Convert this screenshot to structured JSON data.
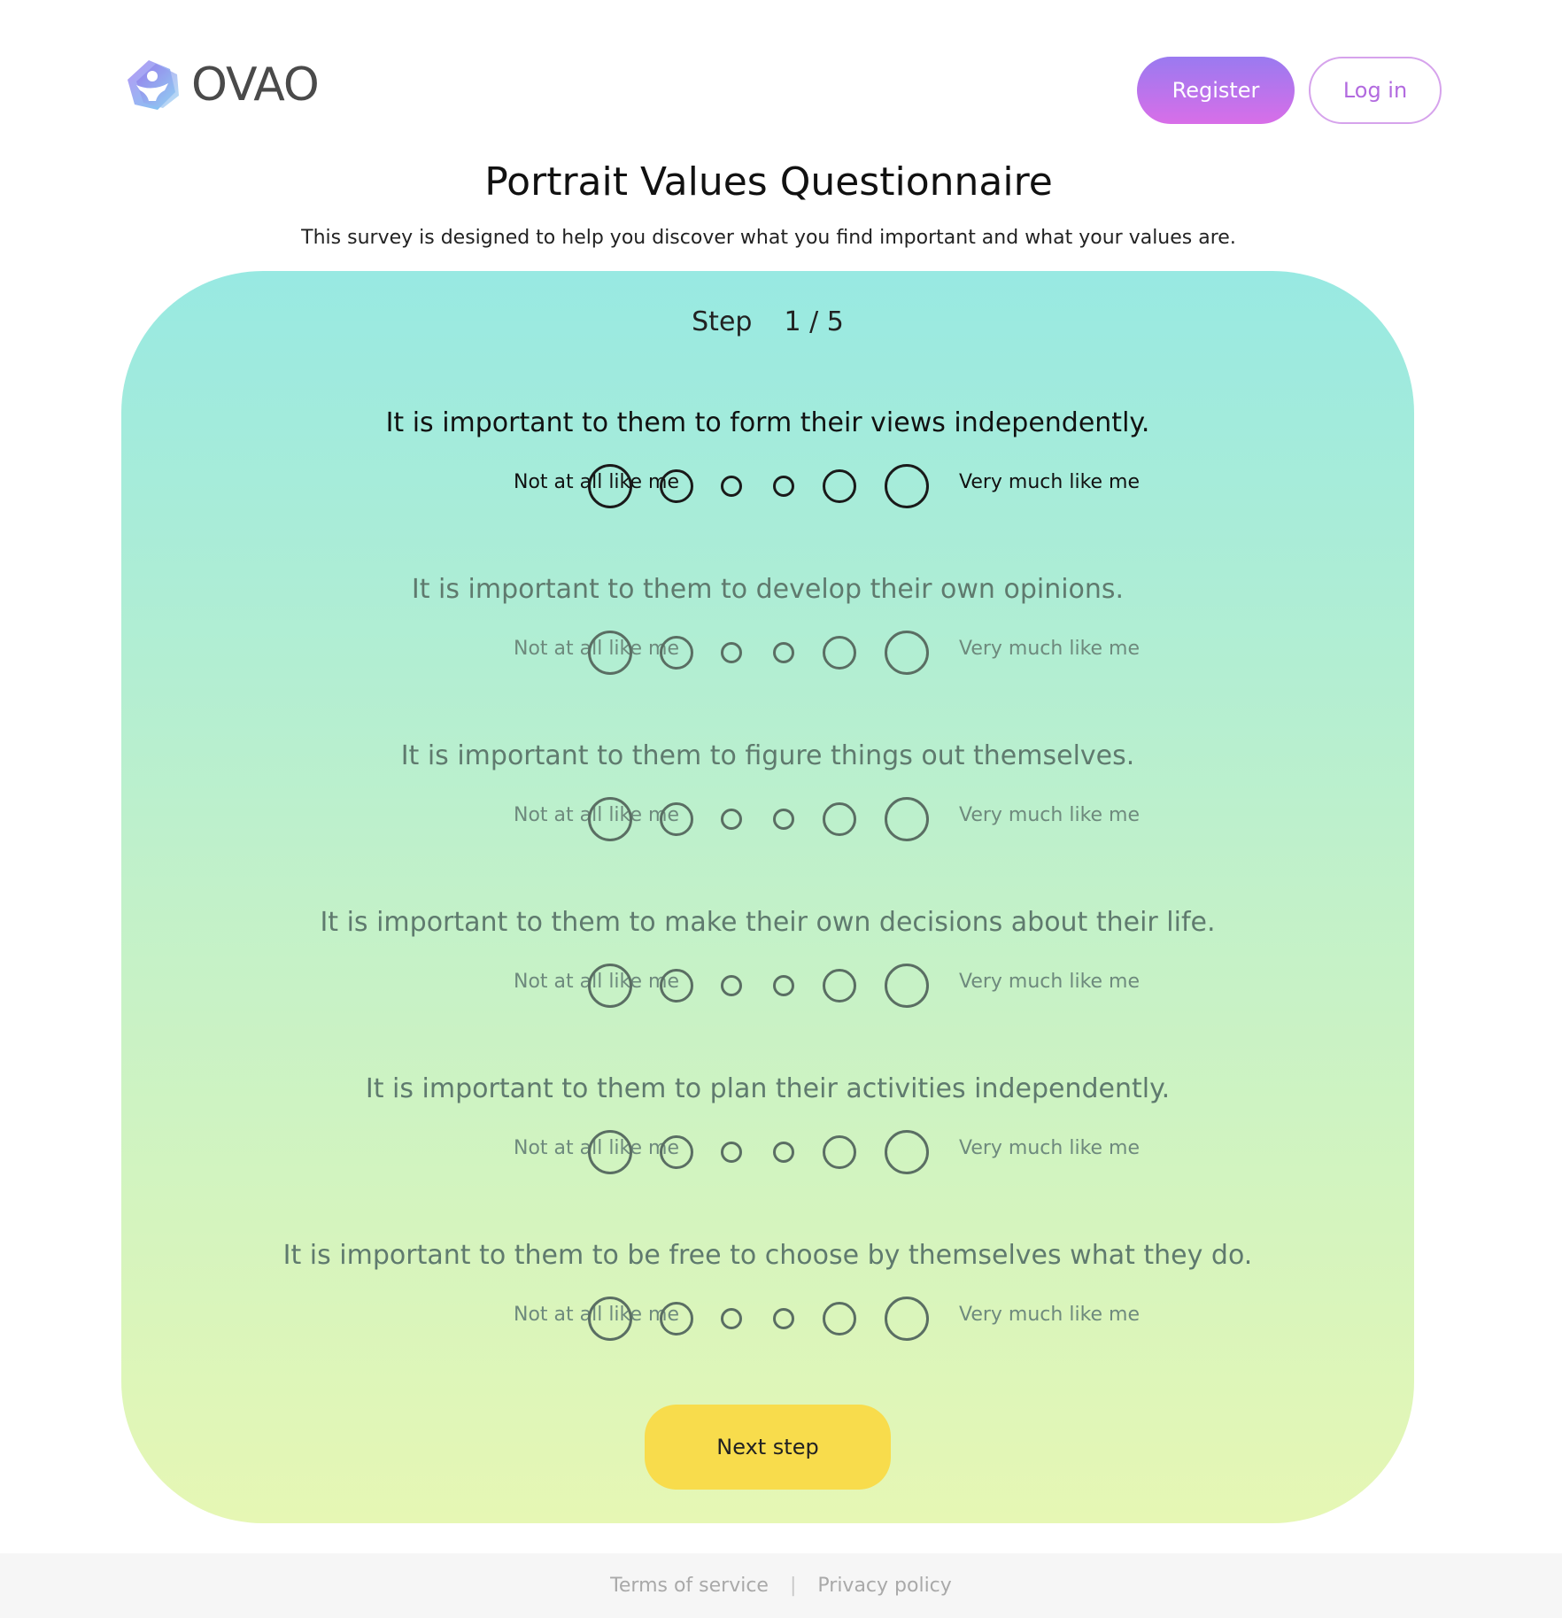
{
  "header": {
    "logo_text": "OVAO",
    "register_label": "Register",
    "login_label": "Log in"
  },
  "page": {
    "title": "Portrait Values Questionnaire",
    "subtitle": "This survey is designed to help you discover what you find important and what your values are."
  },
  "step": {
    "label": "Step",
    "current": "1",
    "separator": "/",
    "total": "5"
  },
  "scale": {
    "left_label": "Not at all like me",
    "right_label": "Very much like me",
    "options_count": 6
  },
  "questions": [
    {
      "text": "It is important to them to form their views independently."
    },
    {
      "text": "It is important to them to develop their own opinions."
    },
    {
      "text": "It is important to them to figure things out themselves."
    },
    {
      "text": "It is important to them to make their own decisions about their life."
    },
    {
      "text": "It is important to them to plan their activities independently."
    },
    {
      "text": "It is important to them to be free to choose by themselves what they do."
    }
  ],
  "next_label": "Next step",
  "footer": {
    "terms_label": "Terms of service",
    "separator": "|",
    "privacy_label": "Privacy policy"
  },
  "colors": {
    "register_gradient_start": "#9a7af0",
    "register_gradient_end": "#d86ee8",
    "card_top": "#98e9e2",
    "card_bottom": "#e6f7b4",
    "next_button": "#f8dc4c"
  }
}
